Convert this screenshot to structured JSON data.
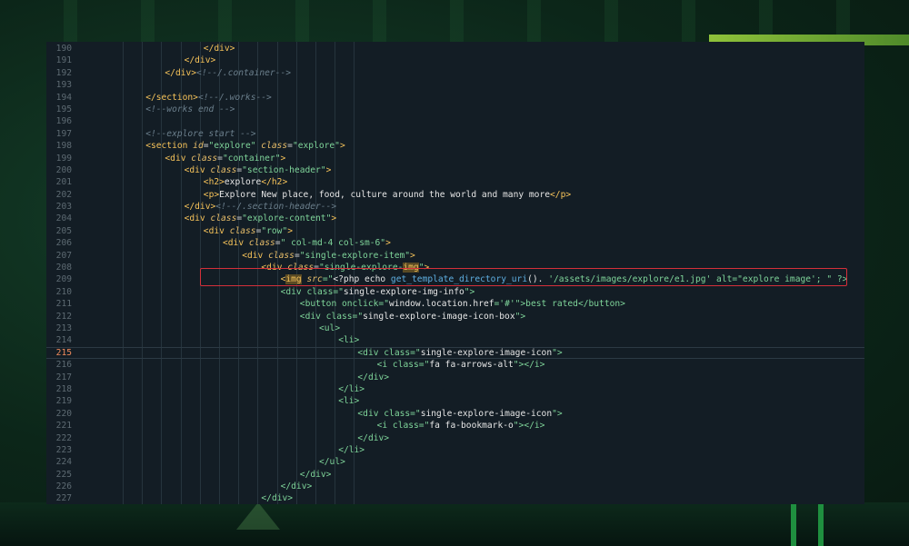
{
  "editor": {
    "active_line": "215",
    "lines": [
      {
        "num": "190",
        "indent": 4,
        "segs": [
          {
            "t": "</div>",
            "c": "tag"
          }
        ]
      },
      {
        "num": "191",
        "indent": 3,
        "segs": [
          {
            "t": "</div>",
            "c": "tag"
          }
        ]
      },
      {
        "num": "192",
        "indent": 2,
        "segs": [
          {
            "t": "</div>",
            "c": "tag"
          },
          {
            "t": "<!--/.container-->",
            "c": "cmt"
          }
        ]
      },
      {
        "num": "193",
        "indent": 0,
        "segs": []
      },
      {
        "num": "194",
        "indent": 1,
        "segs": [
          {
            "t": "</section>",
            "c": "tag"
          },
          {
            "t": "<!--/.works-->",
            "c": "cmt"
          }
        ]
      },
      {
        "num": "195",
        "indent": 1,
        "segs": [
          {
            "t": "<!--works end -->",
            "c": "cmt"
          }
        ]
      },
      {
        "num": "196",
        "indent": 0,
        "segs": []
      },
      {
        "num": "197",
        "indent": 1,
        "segs": [
          {
            "t": "<!--explore start -->",
            "c": "cmt"
          }
        ]
      },
      {
        "num": "198",
        "indent": 1,
        "segs": [
          {
            "t": "<section ",
            "c": "tag"
          },
          {
            "t": "id",
            "c": "attr"
          },
          {
            "t": "=",
            "c": "pl"
          },
          {
            "t": "\"explore\"",
            "c": "str"
          },
          {
            "t": " ",
            "c": "pl"
          },
          {
            "t": "class",
            "c": "attr"
          },
          {
            "t": "=",
            "c": "pl"
          },
          {
            "t": "\"explore\"",
            "c": "str"
          },
          {
            "t": ">",
            "c": "tag"
          }
        ]
      },
      {
        "num": "199",
        "indent": 2,
        "segs": [
          {
            "t": "<div ",
            "c": "tag"
          },
          {
            "t": "class",
            "c": "attr"
          },
          {
            "t": "=",
            "c": "pl"
          },
          {
            "t": "\"container\"",
            "c": "str"
          },
          {
            "t": ">",
            "c": "tag"
          }
        ]
      },
      {
        "num": "200",
        "indent": 3,
        "segs": [
          {
            "t": "<div ",
            "c": "tag"
          },
          {
            "t": "class",
            "c": "attr"
          },
          {
            "t": "=",
            "c": "pl"
          },
          {
            "t": "\"section-header\"",
            "c": "str"
          },
          {
            "t": ">",
            "c": "tag"
          }
        ]
      },
      {
        "num": "201",
        "indent": 4,
        "segs": [
          {
            "t": "<h2>",
            "c": "tag"
          },
          {
            "t": "explore",
            "c": "txw"
          },
          {
            "t": "</h2>",
            "c": "tag"
          }
        ]
      },
      {
        "num": "202",
        "indent": 4,
        "segs": [
          {
            "t": "<p>",
            "c": "tag"
          },
          {
            "t": "Explore New place, food, culture around the world and many more",
            "c": "txw"
          },
          {
            "t": "</p>",
            "c": "tag"
          }
        ]
      },
      {
        "num": "203",
        "indent": 3,
        "segs": [
          {
            "t": "</div>",
            "c": "tag"
          },
          {
            "t": "<!--/.section-header-->",
            "c": "cmt"
          }
        ]
      },
      {
        "num": "204",
        "indent": 3,
        "segs": [
          {
            "t": "<div ",
            "c": "tag"
          },
          {
            "t": "class",
            "c": "attr"
          },
          {
            "t": "=",
            "c": "pl"
          },
          {
            "t": "\"explore-content\"",
            "c": "str"
          },
          {
            "t": ">",
            "c": "tag"
          }
        ]
      },
      {
        "num": "205",
        "indent": 4,
        "segs": [
          {
            "t": "<div ",
            "c": "tag"
          },
          {
            "t": "class",
            "c": "attr"
          },
          {
            "t": "=",
            "c": "pl"
          },
          {
            "t": "\"row\"",
            "c": "str"
          },
          {
            "t": ">",
            "c": "tag"
          }
        ]
      },
      {
        "num": "206",
        "indent": 5,
        "segs": [
          {
            "t": "<div ",
            "c": "tag"
          },
          {
            "t": "class",
            "c": "attr"
          },
          {
            "t": "=",
            "c": "pl"
          },
          {
            "t": "\" col-md-4 col-sm-6\"",
            "c": "str"
          },
          {
            "t": ">",
            "c": "tag"
          }
        ]
      },
      {
        "num": "207",
        "indent": 6,
        "segs": [
          {
            "t": "<div ",
            "c": "tag"
          },
          {
            "t": "class",
            "c": "attr"
          },
          {
            "t": "=",
            "c": "pl"
          },
          {
            "t": "\"single-explore-item\"",
            "c": "str"
          },
          {
            "t": ">",
            "c": "tag"
          }
        ]
      },
      {
        "num": "208",
        "indent": 7,
        "segs": [
          {
            "t": "<div ",
            "c": "tag"
          },
          {
            "t": "class",
            "c": "attr"
          },
          {
            "t": "=",
            "c": "pl"
          },
          {
            "t": "\"single-explore-",
            "c": "str"
          },
          {
            "t": "img",
            "c": "hl"
          },
          {
            "t": "\"",
            "c": "str"
          },
          {
            "t": ">",
            "c": "tag"
          }
        ]
      },
      {
        "num": "209",
        "indent": 8,
        "segs": [
          {
            "t": "<",
            "c": "tag"
          },
          {
            "t": "img",
            "c": "hl"
          },
          {
            "t": " ",
            "c": "pl"
          },
          {
            "t": "src",
            "c": "attr"
          },
          {
            "t": "=\"",
            "c": "str"
          },
          {
            "t": "<?php echo ",
            "c": "txw"
          },
          {
            "t": "get_template_directory_uri",
            "c": "fn"
          },
          {
            "t": "(). ",
            "c": "txw"
          },
          {
            "t": "'/assets/images/explore/e1.jpg'",
            "c": "str"
          },
          {
            "t": " alt=\"explore image'; \" ?>",
            "c": "str"
          }
        ]
      },
      {
        "num": "210",
        "indent": 8,
        "segs": [
          {
            "t": "<div class=\"",
            "c": "str"
          },
          {
            "t": "single-explore-img-info",
            "c": "txw"
          },
          {
            "t": "\">",
            "c": "str"
          }
        ]
      },
      {
        "num": "211",
        "indent": 9,
        "segs": [
          {
            "t": "<button onclick=\"",
            "c": "str"
          },
          {
            "t": "window.location.href",
            "c": "txw"
          },
          {
            "t": "='#'\">best rated</button>",
            "c": "str"
          }
        ]
      },
      {
        "num": "212",
        "indent": 9,
        "segs": [
          {
            "t": "<div class=\"",
            "c": "str"
          },
          {
            "t": "single-explore-image-icon-box",
            "c": "txw"
          },
          {
            "t": "\">",
            "c": "str"
          }
        ]
      },
      {
        "num": "213",
        "indent": 10,
        "segs": [
          {
            "t": "<ul>",
            "c": "str"
          }
        ]
      },
      {
        "num": "214",
        "indent": 11,
        "segs": [
          {
            "t": "<li>",
            "c": "str"
          }
        ]
      },
      {
        "num": "215",
        "indent": 12,
        "segs": [
          {
            "t": "<div class=\"",
            "c": "str"
          },
          {
            "t": "single-explore-image-icon",
            "c": "txw"
          },
          {
            "t": "\">",
            "c": "str"
          }
        ]
      },
      {
        "num": "216",
        "indent": 13,
        "segs": [
          {
            "t": "<i class=\"",
            "c": "str"
          },
          {
            "t": "fa fa-arrows-alt",
            "c": "txw"
          },
          {
            "t": "\"></i>",
            "c": "str"
          }
        ]
      },
      {
        "num": "217",
        "indent": 12,
        "segs": [
          {
            "t": "</div>",
            "c": "str"
          }
        ]
      },
      {
        "num": "218",
        "indent": 11,
        "segs": [
          {
            "t": "</li>",
            "c": "str"
          }
        ]
      },
      {
        "num": "219",
        "indent": 11,
        "segs": [
          {
            "t": "<li>",
            "c": "str"
          }
        ]
      },
      {
        "num": "220",
        "indent": 12,
        "segs": [
          {
            "t": "<div class=\"",
            "c": "str"
          },
          {
            "t": "single-explore-image-icon",
            "c": "txw"
          },
          {
            "t": "\">",
            "c": "str"
          }
        ]
      },
      {
        "num": "221",
        "indent": 13,
        "segs": [
          {
            "t": "<i class=\"",
            "c": "str"
          },
          {
            "t": "fa fa-bookmark-o",
            "c": "txw"
          },
          {
            "t": "\"></i>",
            "c": "str"
          }
        ]
      },
      {
        "num": "222",
        "indent": 12,
        "segs": [
          {
            "t": "</div>",
            "c": "str"
          }
        ]
      },
      {
        "num": "223",
        "indent": 11,
        "segs": [
          {
            "t": "</li>",
            "c": "str"
          }
        ]
      },
      {
        "num": "224",
        "indent": 10,
        "segs": [
          {
            "t": "</ul>",
            "c": "str"
          }
        ]
      },
      {
        "num": "225",
        "indent": 9,
        "segs": [
          {
            "t": "</div>",
            "c": "str"
          }
        ]
      },
      {
        "num": "226",
        "indent": 8,
        "segs": [
          {
            "t": "</div>",
            "c": "str"
          }
        ]
      },
      {
        "num": "227",
        "indent": 7,
        "segs": [
          {
            "t": "</div>",
            "c": "str"
          }
        ]
      }
    ]
  }
}
